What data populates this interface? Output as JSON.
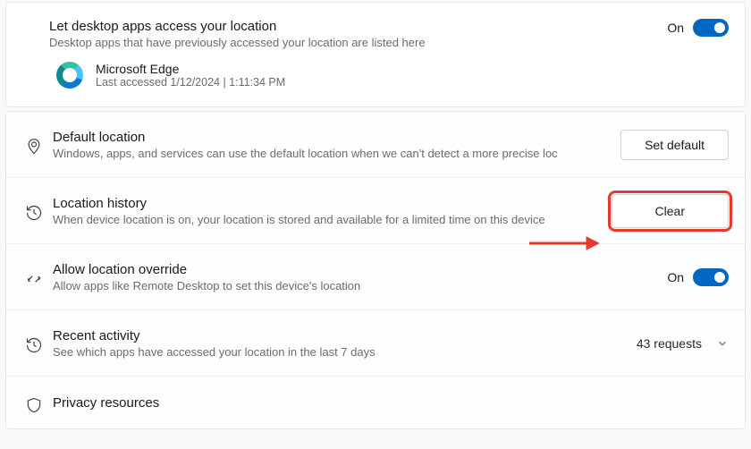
{
  "desktop_apps": {
    "title": "Let desktop apps access your location",
    "subtitle": "Desktop apps that have previously accessed your location are listed here",
    "toggle_label": "On",
    "app": {
      "name": "Microsoft Edge",
      "meta": "Last accessed 1/12/2024  |  1:11:34 PM"
    }
  },
  "default_location": {
    "title": "Default location",
    "subtitle": "Windows, apps, and services can use the default location when we can't detect a more precise loc",
    "button": "Set default"
  },
  "location_history": {
    "title": "Location history",
    "subtitle": "When device location is on, your location is stored and available for a limited time on this device",
    "button": "Clear"
  },
  "override": {
    "title": "Allow location override",
    "subtitle": "Allow apps like Remote Desktop to set this device's location",
    "toggle_label": "On"
  },
  "recent": {
    "title": "Recent activity",
    "subtitle": "See which apps have accessed your location in the last 7 days",
    "count": "43 requests"
  },
  "privacy": {
    "title": "Privacy resources"
  }
}
